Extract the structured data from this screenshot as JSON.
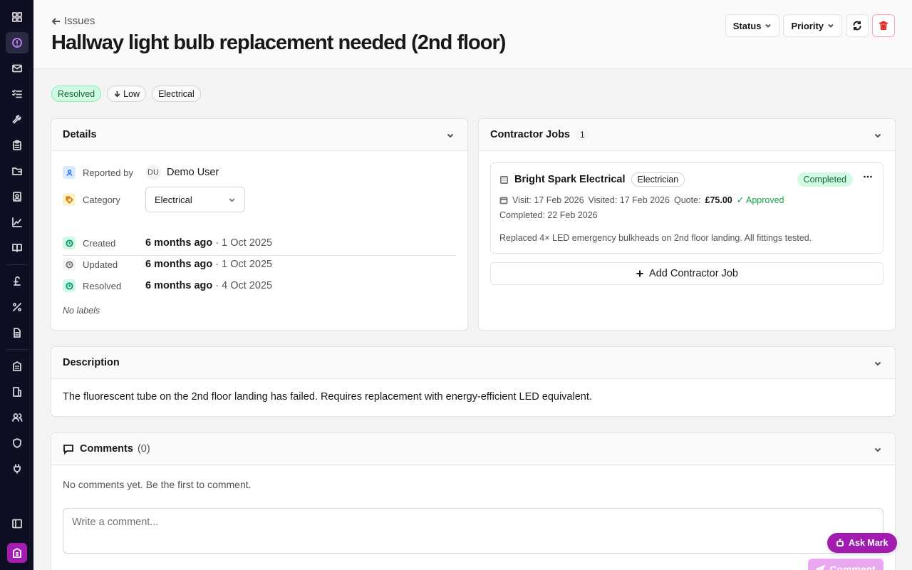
{
  "header": {
    "back_label": "Issues",
    "title": "Hallway light bulb replacement needed (2nd floor)",
    "status_label": "Status",
    "priority_label": "Priority"
  },
  "badges": {
    "status": "Resolved",
    "priority": "Low",
    "category": "Electrical"
  },
  "details": {
    "title": "Details",
    "reported_by_label": "Reported by",
    "reporter_initials": "DU",
    "reporter_name": "Demo User",
    "category_label": "Category",
    "category_value": "Electrical",
    "created_label": "Created",
    "created_relative": "6 months ago",
    "created_date": " · 1 Oct 2025",
    "updated_label": "Updated",
    "updated_relative": "6 months ago",
    "updated_date": " · 1 Oct 2025",
    "resolved_label": "Resolved",
    "resolved_relative": "6 months ago",
    "resolved_date": " · 4 Oct 2025",
    "no_labels": "No labels"
  },
  "contractor": {
    "title": "Contractor Jobs",
    "count": "1",
    "job": {
      "name": "Bright Spark Electrical",
      "trade": "Electrician",
      "status": "Completed",
      "visit": "Visit: 17 Feb 2026",
      "visited": "Visited: 17 Feb 2026",
      "quote_label": "Quote:",
      "quote_value": "£75.00",
      "approved": "✓ Approved",
      "completed": "Completed: 22 Feb 2026",
      "notes": "Replaced 4× LED emergency bulkheads on 2nd floor landing. All fittings tested."
    },
    "add_label": "Add Contractor Job"
  },
  "description": {
    "title": "Description",
    "text": "The fluorescent tube on the 2nd floor landing has failed. Requires replacement with energy-efficient LED equivalent."
  },
  "comments": {
    "title": "Comments",
    "count": "(0)",
    "empty": "No comments yet. Be the first to comment.",
    "placeholder": "Write a comment...",
    "submit_label": "Comment"
  },
  "assistant": {
    "label": "Ask Mark"
  },
  "colors": {
    "sidebar_bg": "#0f0f23",
    "brand": "#a21caf",
    "resolved_bg": "#d1fae5",
    "delete_red": "#dc2626"
  }
}
